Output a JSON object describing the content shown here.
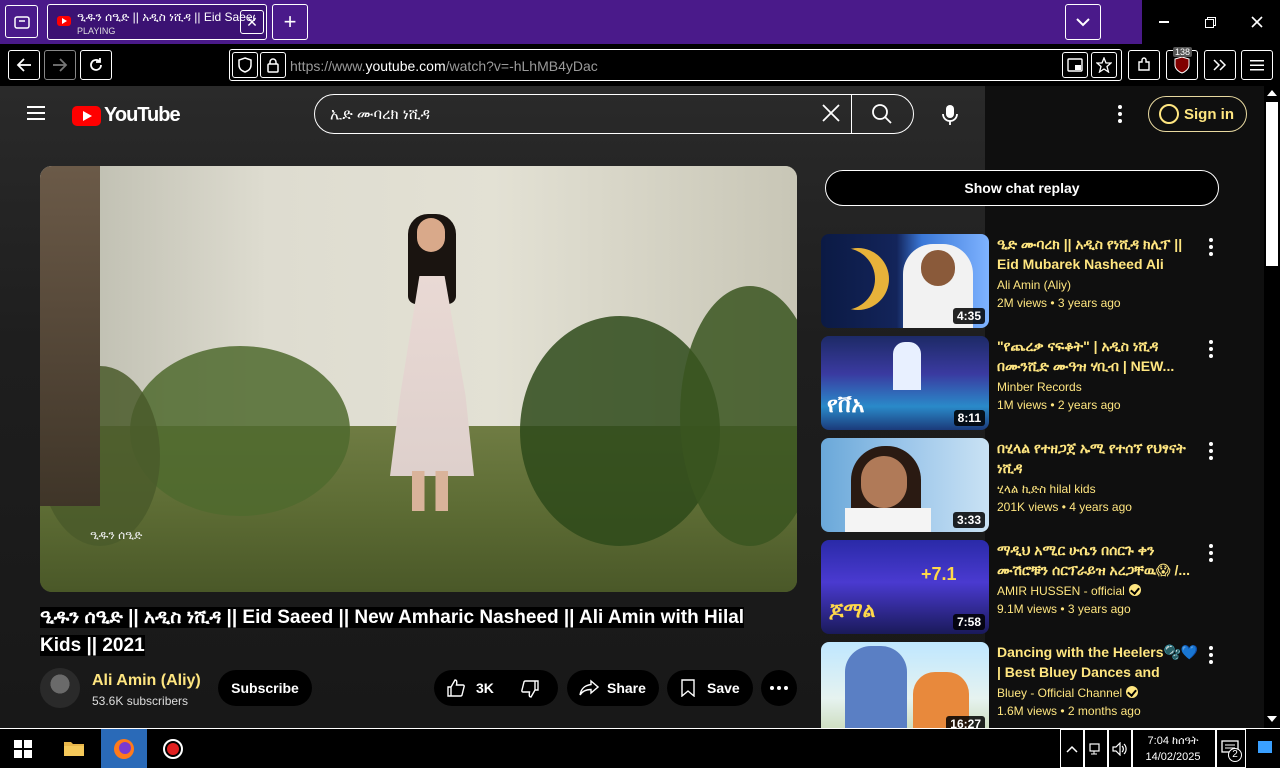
{
  "browser": {
    "tab": {
      "title": "ዒዱን ሰዒድ || አዲስ ነሺዳ || Eid Saeed || New Amharic Nasheed",
      "status": "PLAYING"
    },
    "new_tab_label": "+",
    "url_host": "https://www.",
    "url_domain": "youtube.com",
    "url_path": "/watch?v=-hLhMB4yDac",
    "extension_badge": "138"
  },
  "youtube": {
    "logo_text": "YouTube",
    "search_query": "ኢድ ሙባረክ ነሺዳ",
    "sign_in_label": "Sign in",
    "video": {
      "title": "ዒዱን ሰዒድ || አዲስ ነሺዳ || Eid Saeed || New Amharic Nasheed || Ali Amin with Hilal Kids || 2021",
      "overlay_caption": "ዒዱን ሰዒድ",
      "channel": "Ali Amin (Aliy)",
      "subscribers": "53.6K subscribers",
      "subscribe_label": "Subscribe",
      "likes": "3K",
      "share_label": "Share",
      "save_label": "Save"
    },
    "chat_replay_label": "Show chat replay",
    "recommendations": [
      {
        "title": "ዒድ ሙባረክ || አዲስ የነሺዳ ክሊፕ || Eid Mubarek Nasheed Ali Ami...",
        "channel": "Ali Amin (Aliy)",
        "views": "2M views",
        "age": "3 years ago",
        "duration": "4:35",
        "verified": false
      },
      {
        "title": "\"የጨረቃ ናፍቆት\" | አዲስ ነሺዳ በሙንሺድ ሙዓዝ ሃቢብ | NEW...",
        "channel": "Minber Records",
        "views": "1M views",
        "age": "2 years ago",
        "duration": "8:11",
        "verified": false
      },
      {
        "title": "በሂላል የተዘጋጀ ኡሚ የተሰኘ የህፃናት ነሺዳ",
        "channel": "ሂላል ኪድስ hilal kids",
        "views": "201K views",
        "age": "4 years ago",
        "duration": "3:33",
        "verified": false
      },
      {
        "title": "ማዲህ አሚር ሁሴን በሰርጉ ቀን ሙሽሮቹን ሰርፕራይዝ አረጋቸዉ😱 /...",
        "channel": "AMIR HUSSEN - official",
        "views": "9.1M views",
        "age": "3 years ago",
        "duration": "7:58",
        "verified": true
      },
      {
        "title": "Dancing with the Heelers🫧💙 | Best Bluey Dances and More!...",
        "channel": "Bluey - Official Channel",
        "views": "1.6M views",
        "age": "2 months ago",
        "duration": "16:27",
        "verified": true
      }
    ]
  },
  "taskbar": {
    "time": "7:04 ከሰዓት",
    "date": "14/02/2025",
    "notification_count": "2"
  }
}
